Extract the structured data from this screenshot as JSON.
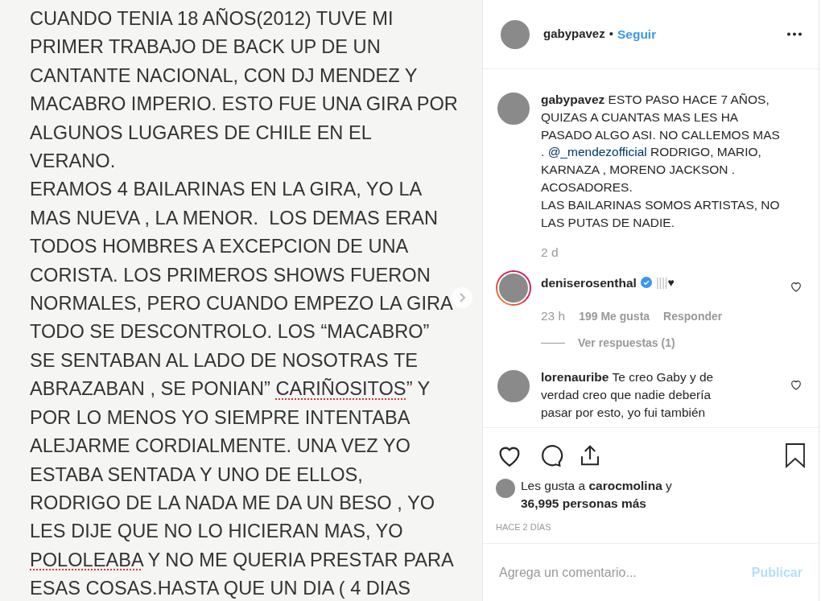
{
  "note_image": {
    "lines": [
      "CUANDO TENIA 18 AÑOS(2012) TUVE MI",
      "PRIMER TRABAJO DE BACK UP DE UN",
      "CANTANTE NACIONAL, CON DJ MENDEZ Y",
      "MACABRO IMPERIO. ESTO FUE UNA GIRA POR",
      "ALGUNOS LUGARES DE CHILE EN EL",
      "VERANO.",
      "ERAMOS 4 BAILARINAS EN LA GIRA, YO LA",
      "MAS NUEVA , LA MENOR.  LOS DEMAS ERAN",
      "TODOS HOMBRES A EXCEPCION DE UNA",
      "CORISTA. LOS PRIMEROS SHOWS FUERON",
      "NORMALES, PERO CUANDO EMPEZO LA GIRA",
      "TODO SE DESCONTROLO. LOS “MACABRO”",
      "SE SENTABAN AL LADO DE NOSOTRAS TE",
      {
        "parts": [
          {
            "text": "ABRAZABAN , SE PONIAN” ",
            "misspelled": false
          },
          {
            "text": "CARIÑOSITOS",
            "misspelled": true
          },
          {
            "text": "” Y",
            "misspelled": false
          }
        ]
      },
      "POR LO MENOS YO SIEMPRE INTENTABA",
      "ALEJARME CORDIALMENTE. UNA VEZ YO",
      "ESTABA SENTADA Y UNO DE ELLOS,",
      "RODRIGO DE LA NADA ME DA UN BESO , YO",
      "LES DIJE QUE NO LO HICIERAN MAS, YO",
      {
        "parts": [
          {
            "text": "POLOLEABA",
            "misspelled": true
          },
          {
            "text": " Y NO ME QUERIA PRESTAR PARA",
            "misspelled": false
          }
        ]
      },
      "ESAS COSAS.HASTA QUE UN DIA ( 4 DIAS"
    ]
  },
  "header": {
    "username": "gabypavez",
    "separator": "•",
    "follow": "Seguir"
  },
  "caption": {
    "username": "gabypavez",
    "text": "ESTO PASO HACE 7 AÑOS, QUIZAS A CUANTAS MAS LES HA PASADO ALGO ASI. NO CALLEMOS MAS . ",
    "mention": "@_mendezofficial",
    "text_after": " RODRIGO, MARIO, KARNAZA , MORENO JACKSON . ACOSADORES.",
    "text_line2": "LAS BAILARINAS SOMOS ARTISTAS, NO LAS PUTAS DE NADIE.",
    "time": "2 d"
  },
  "comments": [
    {
      "username": "deniserosenthal",
      "verified": true,
      "story_ring": true,
      "bars": "||||",
      "emoji": "♥",
      "time": "23 h",
      "likes": "199 Me gusta",
      "reply": "Responder",
      "view_replies": "Ver respuestas (1)"
    },
    {
      "username": "lorenauribe",
      "verified": false,
      "story_ring": false,
      "text": "Te creo Gaby y de verdad creo que nadie debería pasar por esto, yo fui también"
    }
  ],
  "likes": {
    "prefix": "Les gusta a ",
    "user": "carocmolina",
    "middle": " y",
    "count": "36,995 personas más"
  },
  "timestamp": "HACE 2 DÍAS",
  "comment_input": {
    "placeholder": "Agrega un comentario...",
    "submit": "Publicar"
  }
}
